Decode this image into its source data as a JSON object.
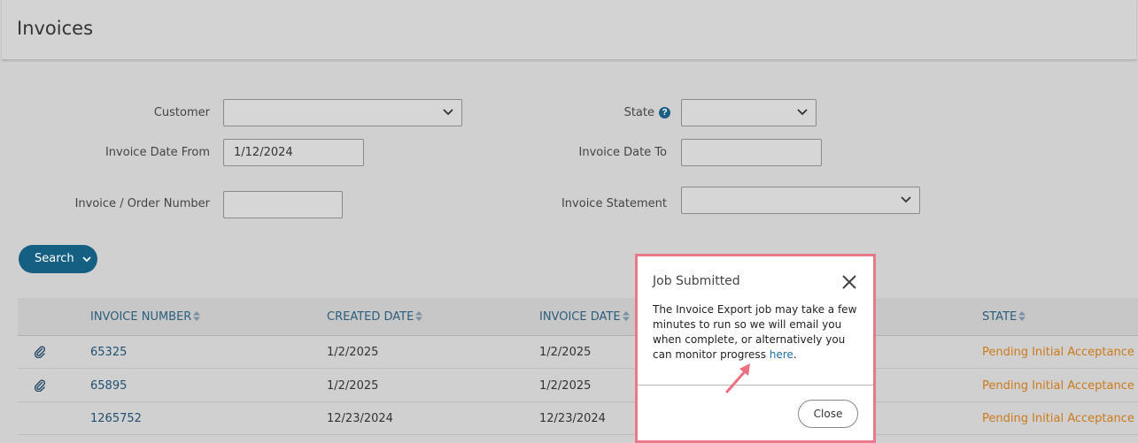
{
  "page": {
    "title": "Invoices"
  },
  "filters": {
    "customer_label": "Customer",
    "customer_value": "",
    "state_label": "State",
    "state_value": "",
    "date_from_label": "Invoice Date From",
    "date_from_value": "1/12/2024",
    "date_to_label": "Invoice Date To",
    "date_to_value": "",
    "order_number_label": "Invoice / Order Number",
    "order_number_value": "",
    "statement_label": "Invoice Statement",
    "statement_value": "",
    "search_label": "Search"
  },
  "table": {
    "columns": [
      "INVOICE NUMBER",
      "CREATED DATE",
      "INVOICE DATE",
      "STATE"
    ],
    "rows": [
      {
        "attachment": true,
        "invoice_number": "65325",
        "created": "1/2/2025",
        "invoice_date": "1/2/2025",
        "state": "Pending Initial Acceptance"
      },
      {
        "attachment": true,
        "invoice_number": "65895",
        "created": "1/2/2025",
        "invoice_date": "1/2/2025",
        "state": "Pending Initial Acceptance"
      },
      {
        "attachment": false,
        "invoice_number": "1265752",
        "created": "12/23/2024",
        "invoice_date": "12/23/2024",
        "state": "Pending Initial Acceptance"
      }
    ]
  },
  "modal": {
    "title": "Job Submitted",
    "body": "The Invoice Export job may take a few minutes to run so we will email you when complete, or alternatively you can monitor progress ",
    "link": "here",
    "body_end": ".",
    "close_label": "Close"
  },
  "colors": {
    "accent": "#155f82",
    "state": "#cc7a1a",
    "highlight": "#e8788a"
  }
}
